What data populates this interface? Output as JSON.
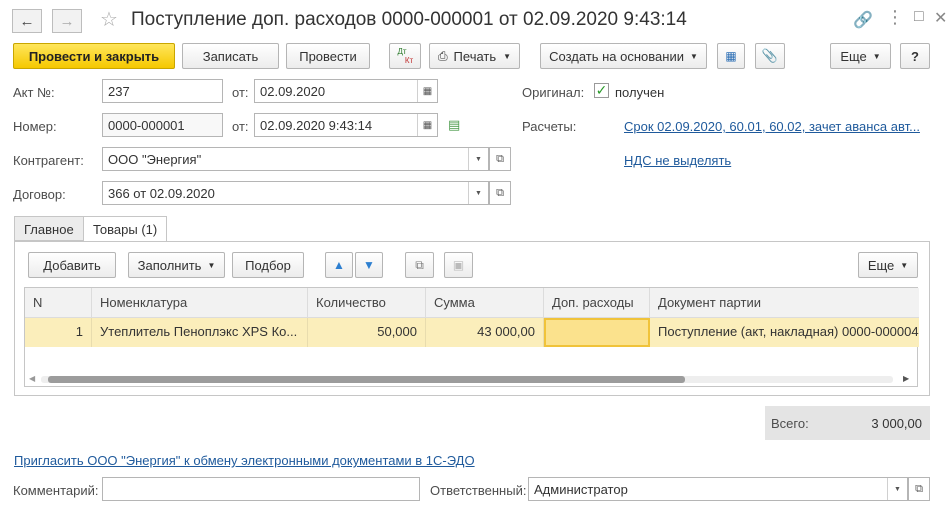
{
  "window": {
    "title": "Поступление доп. расходов 0000-000001 от 02.09.2020 9:43:14"
  },
  "toolbar": {
    "post_close": "Провести и закрыть",
    "save": "Записать",
    "post": "Провести",
    "dt_kt_top": "Дт",
    "dt_kt_bottom": "Кт",
    "print": "Печать",
    "create_based": "Создать на основании",
    "more": "Еще",
    "help": "?"
  },
  "form": {
    "act_label": "Акт №:",
    "act_value": "237",
    "from_label": "от:",
    "act_date": "02.09.2020",
    "number_label": "Номер:",
    "number_value": "0000-000001",
    "from_label2": "от:",
    "number_date": "02.09.2020  9:43:14",
    "counterparty_label": "Контрагент:",
    "counterparty_value": "ООО \"Энергия\"",
    "contract_label": "Договор:",
    "contract_value": "366 от 02.09.2020",
    "original_label": "Оригинал:",
    "original_value": "получен",
    "settlements_label": "Расчеты:",
    "settlements_link": "Срок 02.09.2020, 60.01, 60.02, зачет аванса авт...",
    "vat_link": "НДС не выделять"
  },
  "tabs": [
    {
      "label": "Главное"
    },
    {
      "label": "Товары (1)"
    }
  ],
  "goods": {
    "add": "Добавить",
    "fill": "Заполнить",
    "pick": "Подбор",
    "more": "Еще",
    "columns": [
      "N",
      "Номенклатура",
      "Количество",
      "Сумма",
      "Доп. расходы",
      "Документ партии"
    ],
    "rows": [
      [
        "1",
        "Утеплитель Пеноплэкс XPS Ко...",
        "50,000",
        "43 000,00",
        "",
        "Поступление (акт, накладная) 0000-000004"
      ]
    ]
  },
  "total": {
    "label": "Всего:",
    "value": "3 000,00"
  },
  "footer": {
    "invite_link": "Пригласить ООО \"Энергия\" к обмену электронными документами в 1С-ЭДО",
    "comment_label": "Комментарий:",
    "comment_value": "",
    "responsible_label": "Ответственный:",
    "responsible_value": "Администратор"
  }
}
